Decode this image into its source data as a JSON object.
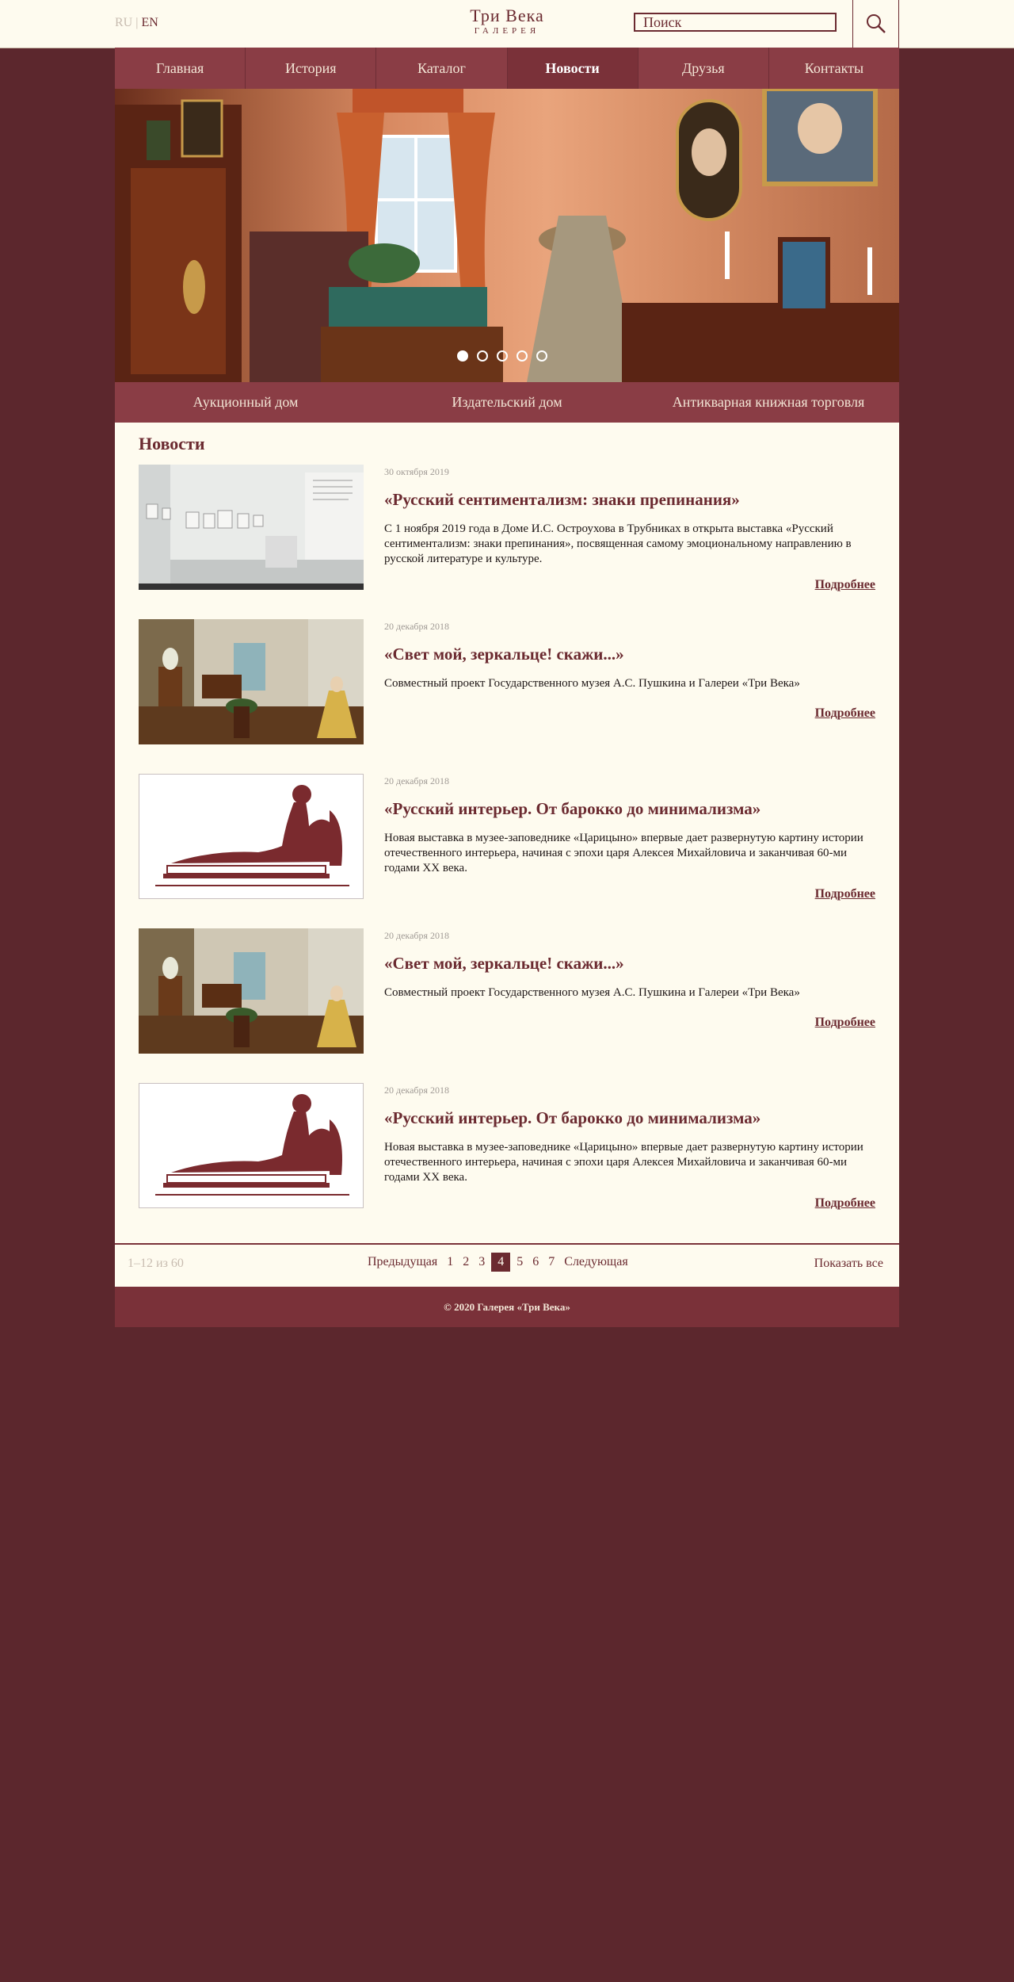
{
  "header": {
    "lang_ru": "RU",
    "lang_sep": "|",
    "lang_en": "EN",
    "logo_line1": "Три Века",
    "logo_line2": "ГАЛЕРЕЯ",
    "search_placeholder": "Поиск"
  },
  "nav": [
    {
      "label": "Главная"
    },
    {
      "label": "История"
    },
    {
      "label": "Каталог"
    },
    {
      "label": "Новости",
      "active": true
    },
    {
      "label": "Друзья"
    },
    {
      "label": "Контакты"
    }
  ],
  "slider": {
    "slides": 5,
    "active_index": 0
  },
  "subnav": [
    {
      "label": "Аукционный дом"
    },
    {
      "label": "Издательский дом"
    },
    {
      "label": "Антикварная книжная торговля"
    }
  ],
  "news": {
    "heading": "Новости",
    "more_label": "Подробнее",
    "items": [
      {
        "date": "30 октября 2019",
        "title": "«Русский сентиментализм: знаки препинания»",
        "excerpt": "С 1 ноября 2019 года в Доме И.С. Остроухова в Трубниках в открыта выставка «Русский сентиментализм: знаки препинания», посвященная самому эмоциональному направлению в русской литературе и культуре.",
        "image": "gallery-room-photo"
      },
      {
        "date": "20 декабря 2018",
        "title": "«Свет мой, зеркальце! скажи...»",
        "excerpt": "Совместный проект Государственного музея А.С. Пушкина и Галереи «Три Века»",
        "image": "mirror-exhibition-photo"
      },
      {
        "date": "20 декабря 2018",
        "title": "«Русский интерьер. От барокко до минимализма»",
        "excerpt": "Новая выставка в музее-заповеднике «Царицыно» впервые дает развернутую картину истории отечественного интерьера, начиная с эпохи царя Алексея Михайловича и заканчивая 60-ми годами XX века.",
        "image": "reclining-figure-drawing"
      },
      {
        "date": "20 декабря 2018",
        "title": "«Свет мой, зеркальце! скажи...»",
        "excerpt": "Совместный проект Государственного музея А.С. Пушкина и Галереи «Три Века»",
        "image": "mirror-exhibition-photo"
      },
      {
        "date": "20 декабря 2018",
        "title": "«Русский интерьер. От барокко до минимализма»",
        "excerpt": "Новая выставка в музее-заповеднике «Царицыно» впервые дает развернутую картину истории отечественного интерьера, начиная с эпохи царя Алексея Михайловича и заканчивая 60-ми годами XX века.",
        "image": "reclining-figure-drawing"
      }
    ]
  },
  "pager": {
    "count_text": "1–12 из 60",
    "prev": "Предыдущая",
    "pages": [
      "1",
      "2",
      "3",
      "4",
      "5",
      "6",
      "7"
    ],
    "current": "4",
    "next": "Следующая",
    "show_all": "Показать все"
  },
  "footer": {
    "copyright": "© 2020 Галерея «Три Века»"
  },
  "colors": {
    "brand": "#6b2a30",
    "nav_bg": "#8a3d45",
    "page_bg": "#5c272d",
    "content_bg": "#fefbef"
  }
}
